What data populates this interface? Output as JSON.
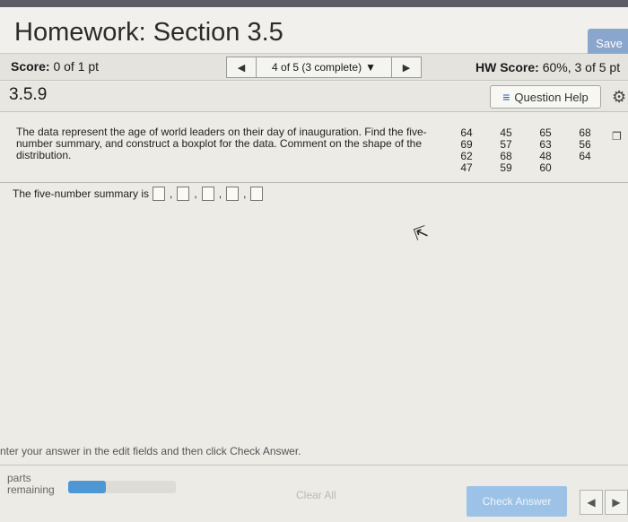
{
  "header": {
    "title": "Homework: Section 3.5",
    "save_label": "Save"
  },
  "score_bar": {
    "score_label": "Score:",
    "score_value": "0 of 1 pt",
    "nav_position": "4 of 5 (3 complete)",
    "hw_score_label": "HW Score:",
    "hw_score_value": "60%, 3 of 5 pt"
  },
  "question": {
    "id": "3.5.9",
    "help_label": "Question Help",
    "text": "The data represent the age of world leaders on their day of inauguration. Find the five-number summary, and construct a boxplot for the data. Comment on the shape of the distribution.",
    "data_rows": [
      [
        "64",
        "45",
        "65",
        "68"
      ],
      [
        "69",
        "57",
        "63",
        "56"
      ],
      [
        "62",
        "68",
        "48",
        "64"
      ],
      [
        "47",
        "59",
        "60",
        ""
      ]
    ],
    "summary_label": "The five-number summary is"
  },
  "footer": {
    "instruction": "nter your answer in the edit fields and then click Check Answer.",
    "parts_remaining": "parts\nremaining",
    "parts_progress": 0.35,
    "clear_all_label": "Clear All",
    "check_answer_label": "Check Answer"
  },
  "icons": {
    "nav_prev": "triangle-left-icon",
    "nav_next": "triangle-right-icon",
    "dropdown": "chevron-down-icon",
    "help": "list-icon",
    "settings": "gear-icon",
    "copy": "copy-icon",
    "cursor": "mouse-pointer-icon"
  },
  "colors": {
    "save_button": "#8aa6cf",
    "progress_fill": "#4d97d4",
    "check_button": "#9cc3e7",
    "help_icon": "#1f5fb8"
  }
}
